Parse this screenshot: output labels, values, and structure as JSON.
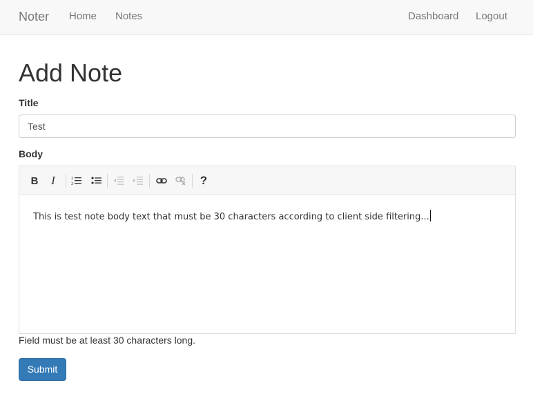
{
  "navbar": {
    "brand": "Noter",
    "left_links": [
      {
        "label": "Home"
      },
      {
        "label": "Notes"
      }
    ],
    "right_links": [
      {
        "label": "Dashboard"
      },
      {
        "label": "Logout"
      }
    ]
  },
  "page": {
    "title": "Add Note"
  },
  "form": {
    "title_label": "Title",
    "title_value": "Test",
    "body_label": "Body",
    "body_text": "This is test note body text that must be 30 characters according to client side filtering...",
    "help_text": "Field must be at least 30 characters long.",
    "submit_label": "Submit"
  },
  "toolbar": {
    "bold_glyph": "B",
    "italic_glyph": "I",
    "help_glyph": "?",
    "icons": [
      "bold-icon",
      "italic-icon",
      "ordered-list-icon",
      "unordered-list-icon",
      "outdent-icon",
      "indent-icon",
      "link-icon",
      "unlink-icon",
      "help-icon"
    ]
  },
  "colors": {
    "navbar_bg": "#f8f8f8",
    "primary": "#337ab7",
    "text": "#333333",
    "muted": "#777777"
  }
}
